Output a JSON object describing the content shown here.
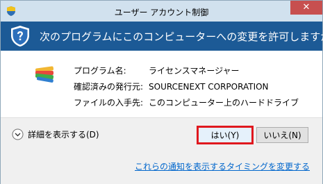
{
  "window": {
    "title": "ユーザー アカウント制御"
  },
  "banner": {
    "question": "次のプログラムにこのコンピューターへの変更を許可しますか?"
  },
  "details": {
    "rows": [
      {
        "label": "プログラム名:",
        "value": "ライセンスマネージャー"
      },
      {
        "label": "確認済みの発行元:",
        "value": "SOURCENEXT CORPORATION"
      },
      {
        "label": "ファイルの入手先:",
        "value": "このコンピューター上のハードドライブ"
      }
    ]
  },
  "footer": {
    "show_details": "詳細を表示する(D)",
    "yes_label": "はい(Y)",
    "no_label": "いいえ(N)",
    "change_link": "これらの通知を表示するタイミングを変更する"
  },
  "colors": {
    "banner_bg": "#1c5a96",
    "titlebar_bg": "#d1e1ee",
    "close_bg": "#c74f4f",
    "highlight_border": "#e0181e",
    "link": "#0066cc"
  },
  "icons": {
    "title": "uac-shield-icon",
    "banner": "uac-shield-icon",
    "program": "license-manager-app-icon",
    "close": "close-icon",
    "details": "chevron-down-circle-icon"
  }
}
